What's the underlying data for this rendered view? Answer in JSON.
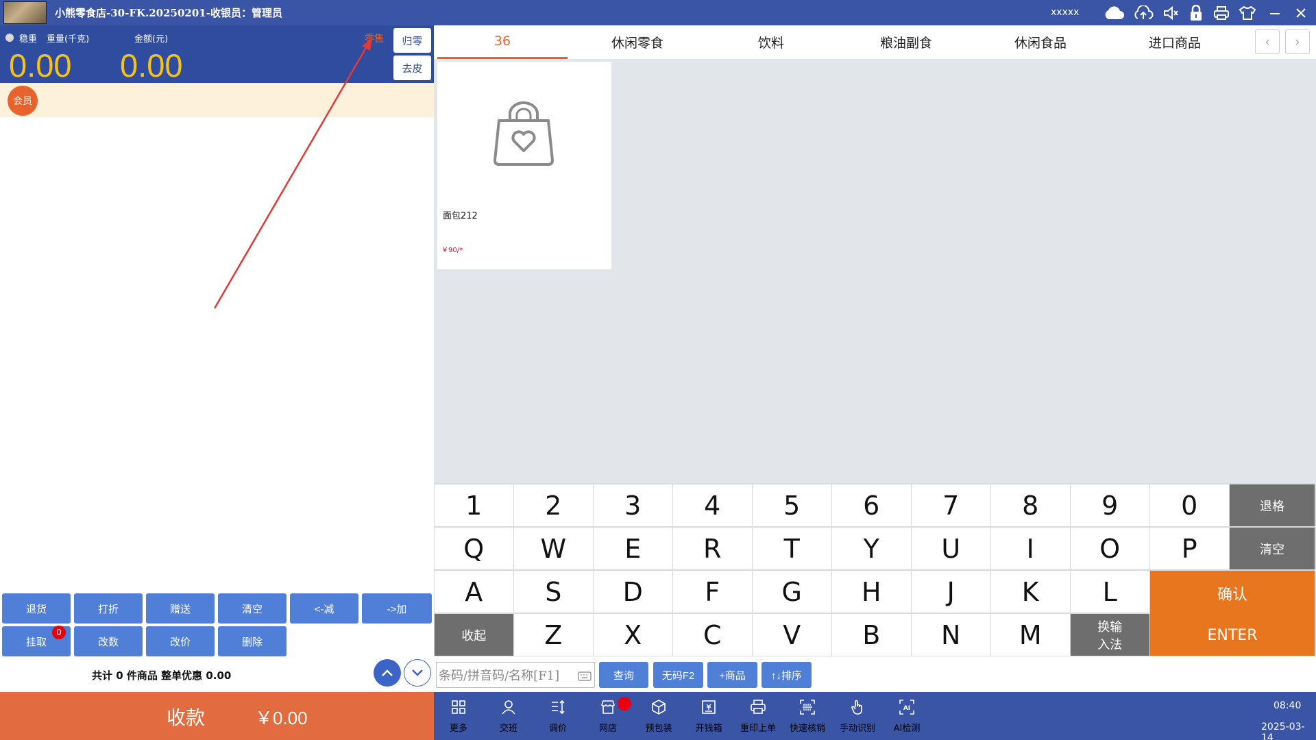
{
  "titlebar": {
    "title": "小熊零食店-30-FK.20250201-收银员：管理员",
    "user": "xxxxx",
    "icons": [
      "cloud-icon",
      "cloud-upload-icon",
      "speaker-icon",
      "lock-icon",
      "printer-icon",
      "shirt-icon",
      "minimize-icon",
      "close-icon"
    ]
  },
  "scale": {
    "stable_label": "稳重",
    "weight_label": "重量(千克)",
    "amount_label": "金额(元)",
    "weight_value": "0.00",
    "amount_value": "0.00",
    "mode_label": "零售",
    "zero_button": "归零",
    "tare_button": "去皮"
  },
  "member": {
    "badge": "会员"
  },
  "actions": {
    "row1": [
      "退货",
      "打折",
      "赠送",
      "清空",
      "<-减",
      "->加"
    ],
    "row2": [
      "挂取",
      "改数",
      "改价",
      "删除"
    ],
    "hold_count": "0"
  },
  "summary": "共计 0 件商品 整单优惠 0.00",
  "checkout": {
    "label": "收款",
    "total": "￥0.00"
  },
  "tabs": [
    "36",
    "休闲零食",
    "饮料",
    "粮油副食",
    "休闲食品",
    "进口商品"
  ],
  "active_tab": 0,
  "products": [
    {
      "name": "面包212",
      "price": "￥90/*"
    }
  ],
  "keyboard": {
    "row1": [
      "1",
      "2",
      "3",
      "4",
      "5",
      "6",
      "7",
      "8",
      "9",
      "0"
    ],
    "row2": [
      "Q",
      "W",
      "E",
      "R",
      "T",
      "Y",
      "U",
      "I",
      "O",
      "P"
    ],
    "row3": [
      "A",
      "S",
      "D",
      "F",
      "G",
      "H",
      "J",
      "K",
      "L"
    ],
    "row4": [
      "Z",
      "X",
      "C",
      "V",
      "B",
      "N",
      "M"
    ],
    "backspace": "退格",
    "clear": "清空",
    "collapse": "收起",
    "ime_line1": "换输",
    "ime_line2": "入法",
    "confirm": "确认",
    "enter": "ENTER"
  },
  "search": {
    "placeholder": "条码/拼音码/名称[F1]",
    "query": "查询",
    "no_code": "无码F2",
    "add_product": "+商品",
    "sort": "↑↓排序"
  },
  "bottom": [
    {
      "label": "更多",
      "icon": "grid-icon"
    },
    {
      "label": "交班",
      "icon": "user-icon"
    },
    {
      "label": "调价",
      "icon": "adjust-price-icon"
    },
    {
      "label": "网店",
      "icon": "store-icon"
    },
    {
      "label": "预包装",
      "icon": "package-icon"
    },
    {
      "label": "开钱箱",
      "icon": "cash-drawer-icon"
    },
    {
      "label": "重印上单",
      "icon": "printer-icon"
    },
    {
      "label": "快速核销",
      "icon": "scan-icon"
    },
    {
      "label": "手动识别",
      "icon": "hand-icon"
    },
    {
      "label": "AI检测",
      "icon": "ai-icon"
    }
  ],
  "clock": {
    "time": "08:40",
    "date": "2025-03-14"
  }
}
